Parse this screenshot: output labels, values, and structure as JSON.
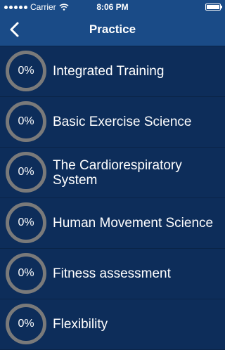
{
  "status_bar": {
    "carrier": "Carrier",
    "time": "8:06 PM"
  },
  "nav": {
    "title": "Practice",
    "back_icon": "chevron-left-icon"
  },
  "items": [
    {
      "progress": "0%",
      "label": "Integrated Training"
    },
    {
      "progress": "0%",
      "label": "Basic Exercise Science"
    },
    {
      "progress": "0%",
      "label": "The Cardiorespiratory System"
    },
    {
      "progress": "0%",
      "label": "Human Movement Science"
    },
    {
      "progress": "0%",
      "label": "Fitness assessment"
    },
    {
      "progress": "0%",
      "label": "Flexibility"
    }
  ],
  "colors": {
    "background": "#0d2d5a",
    "bar": "#1a4b87",
    "ring": "#7a7a7a"
  }
}
